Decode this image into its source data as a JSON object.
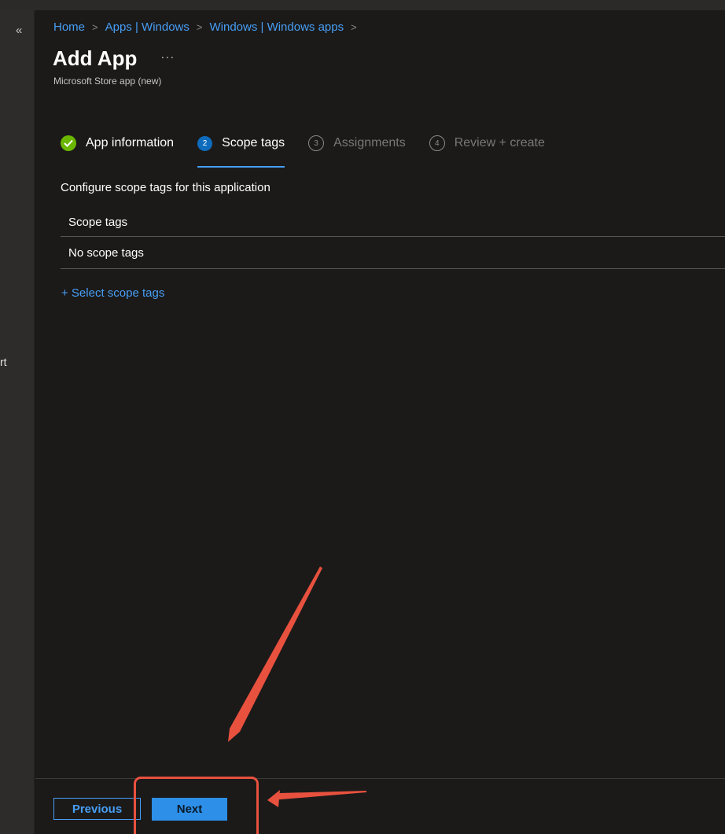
{
  "nav": {
    "collapse_glyph": "«",
    "truncated_text": "rt"
  },
  "breadcrumb": [
    {
      "label": "Home"
    },
    {
      "label": "Apps | Windows"
    },
    {
      "label": "Windows | Windows apps"
    }
  ],
  "breadcrumb_separator": ">",
  "header": {
    "title": "Add App",
    "more_glyph": "···",
    "subtitle": "Microsoft Store app (new)"
  },
  "wizard": {
    "steps": [
      {
        "number": "",
        "label": "App information",
        "state": "done"
      },
      {
        "number": "2",
        "label": "Scope tags",
        "state": "active"
      },
      {
        "number": "3",
        "label": "Assignments",
        "state": "pending"
      },
      {
        "number": "4",
        "label": "Review + create",
        "state": "pending"
      }
    ]
  },
  "content": {
    "description": "Configure scope tags for this application",
    "table_header": "Scope tags",
    "empty_row": "No scope tags",
    "select_link": "+ Select scope tags"
  },
  "footer": {
    "previous_label": "Previous",
    "next_label": "Next"
  },
  "annotation": {
    "color": "#e8513e"
  },
  "colors": {
    "link": "#479ef5",
    "done": "#6bb700",
    "active": "#0f6cbd",
    "primary_button": "#2d8fe7"
  }
}
